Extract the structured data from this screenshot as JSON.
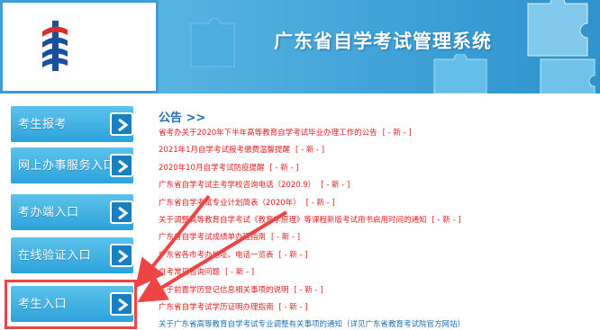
{
  "header": {
    "title": "广东省自学考试管理系统"
  },
  "sidebar": {
    "items": [
      {
        "label": "考生报考"
      },
      {
        "label": "网上办事服务入口"
      },
      {
        "label": "考办端入口"
      },
      {
        "label": "在线验证入口"
      },
      {
        "label": "考生入口"
      }
    ]
  },
  "notices": {
    "title": "公告 >>",
    "new_tag": "[ - 新 - ]",
    "items": [
      {
        "text": "省考办关于2020年下半年高等教育自学考试毕业办理工作的公告",
        "has_new": true
      },
      {
        "text": "2021年1月自学考试报考缴费温馨提醒",
        "has_new": true
      },
      {
        "text": "2020年10月自学考试防疫提醒",
        "has_new": true
      },
      {
        "text": "广东省自学考试主考学校咨询电话（2020.9）",
        "has_new": true
      },
      {
        "text": "广东省自学考试专业计划简表（2020年）",
        "has_new": true
      },
      {
        "text": "关于调整高等教育自学考试《教育学原理》等课程新版考试用书启用时间的通知",
        "has_new": true
      },
      {
        "text": "广东省自学考试成绩单办理指南",
        "has_new": true
      },
      {
        "text": "广东省各市考办地址、电话一览表",
        "has_new": true
      },
      {
        "text": "自考常见咨询问题",
        "has_new": true
      },
      {
        "text": "关于前置学历登记信息相关事项的说明",
        "has_new": true
      },
      {
        "text": "广东省自学考试学历证明办理指南",
        "has_new": true
      },
      {
        "text": "关于广东省高等教育自学考试专业调整有关事项的通知（详见广东省教育考试院官方网站）",
        "has_new": false
      }
    ]
  },
  "colors": {
    "accent_blue": "#2ca3dc",
    "title_blue": "#1f6fb0",
    "notice_red": "#dd2222",
    "annotation_red": "#ef4444"
  },
  "icons": {
    "nav_arrow": "chevron-right-icon",
    "logo": "exam-logo-icon"
  }
}
